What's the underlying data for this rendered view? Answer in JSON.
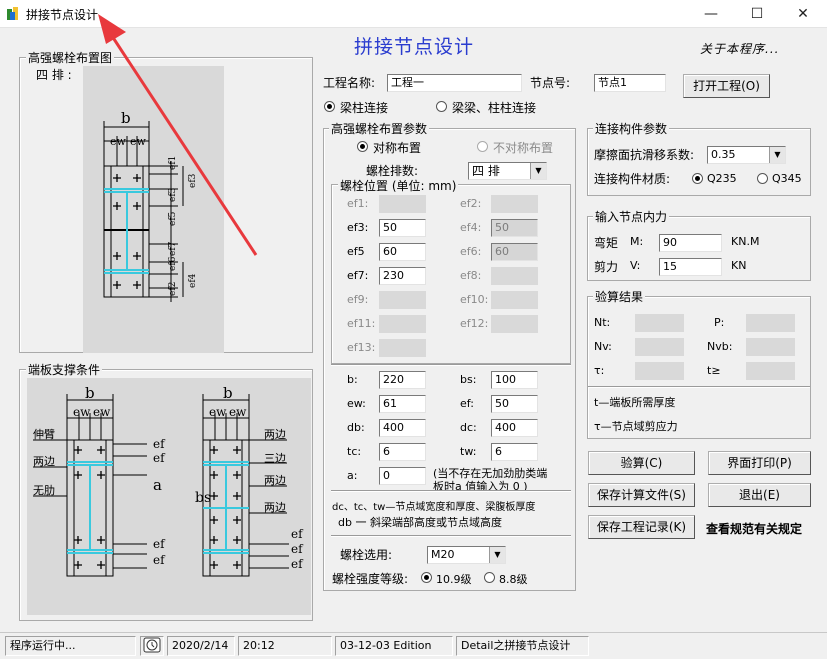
{
  "window": {
    "title": "拼接节点设计",
    "minimize": "—",
    "maximize": "☐",
    "close": "✕"
  },
  "header": {
    "main_title": "拼接节点设计",
    "about": "关于本程序..."
  },
  "bolt_layout_panel": {
    "title": "高强螺栓布置图",
    "rows_label": "四 排 :",
    "drawing": {
      "b": "b",
      "ew1": "ew",
      "ew2": "ew",
      "ef1": "ef1",
      "ef3": "ef3",
      "ef5": "ef5",
      "ef7": "ef7",
      "ef6": "ef6",
      "ef2": "ef2",
      "ef4": "ef4"
    }
  },
  "support_panel": {
    "title": "端板支撑条件",
    "left_labels": [
      "伸臂",
      "两边",
      "无肋"
    ],
    "right_labels": [
      "两边",
      "三边",
      "两边",
      "两边"
    ],
    "b": "b",
    "ew": "ew",
    "ef": "ef",
    "a": "a",
    "bs": "bs"
  },
  "project": {
    "name_label": "工程名称:",
    "name_value": "工程一",
    "node_label": "节点号:",
    "node_value": "节点1",
    "open_button": "打开工程(O)",
    "connection_types": [
      {
        "label": "梁柱连接",
        "selected": true
      },
      {
        "label": "梁梁、柱柱连接",
        "selected": false
      }
    ]
  },
  "bolt_params": {
    "title": "高强螺栓布置参数",
    "symmetric": "对称布置",
    "asymmetric": "不对称布置",
    "rows_label": "螺栓排数:",
    "rows_value": "四 排",
    "position_title": "螺栓位置 (单位: mm)",
    "left": [
      {
        "label": "ef1:",
        "value": "",
        "enabled": false
      },
      {
        "label": "ef3:",
        "value": "50",
        "enabled": true
      },
      {
        "label": "ef5",
        "value": "60",
        "enabled": true
      },
      {
        "label": "ef7:",
        "value": "230",
        "enabled": true
      },
      {
        "label": "ef9:",
        "value": "",
        "enabled": false
      },
      {
        "label": "ef11:",
        "value": "",
        "enabled": false
      },
      {
        "label": "ef13:",
        "value": "",
        "enabled": false
      }
    ],
    "right": [
      {
        "label": "ef2:",
        "value": "",
        "enabled": false
      },
      {
        "label": "ef4:",
        "value": "50",
        "enabled": false
      },
      {
        "label": "ef6:",
        "value": "60",
        "enabled": false
      },
      {
        "label": "ef8:",
        "value": "",
        "enabled": false
      },
      {
        "label": "ef10:",
        "value": "",
        "enabled": false
      },
      {
        "label": "ef12:",
        "value": "",
        "enabled": false
      }
    ],
    "dims_left": [
      {
        "label": "b:",
        "value": "220"
      },
      {
        "label": "ew:",
        "value": "61"
      },
      {
        "label": "db:",
        "value": "400"
      },
      {
        "label": "tc:",
        "value": "6"
      },
      {
        "label": "a:",
        "value": "0"
      }
    ],
    "dims_right": [
      {
        "label": "bs:",
        "value": "100"
      },
      {
        "label": "ef:",
        "value": "50"
      },
      {
        "label": "dc:",
        "value": "400"
      },
      {
        "label": "tw:",
        "value": "6"
      }
    ],
    "a_note_line1": "(当不存在无加劲肋类端",
    "a_note_line2": "板时a 值输入为 0 )",
    "note_line1": "dc、tc、tw—节点域宽度和厚度、梁腹板厚度",
    "note_line2": "db 一 斜梁端部高度或节点域高度",
    "bolt_select_label": "螺栓选用:",
    "bolt_select_value": "M20",
    "grade_label": "螺栓强度等级:",
    "grades": [
      {
        "label": "10.9级",
        "selected": true
      },
      {
        "label": "8.8级",
        "selected": false
      }
    ]
  },
  "member_params": {
    "title": "连接构件参数",
    "friction_label": "摩擦面抗滑移系数:",
    "friction_value": "0.35",
    "material_label": "连接构件材质:",
    "materials": [
      {
        "label": "Q235",
        "selected": true
      },
      {
        "label": "Q345",
        "selected": false
      }
    ]
  },
  "forces": {
    "title": "输入节点内力",
    "moment_label": "弯矩",
    "moment_sym": "M:",
    "moment_value": "90",
    "moment_unit": "KN.M",
    "shear_label": "剪力",
    "shear_sym": "V:",
    "shear_value": "15",
    "shear_unit": "KN"
  },
  "results": {
    "title": "验算结果",
    "labels": [
      "Nt:",
      "P:",
      "Nv:",
      "Nvb:",
      "τ:",
      "t≥"
    ],
    "note1": "t—端板所需厚度",
    "note2": "τ—节点域剪应力"
  },
  "buttons": {
    "check": "验算(C)",
    "print": "界面打印(P)",
    "save_calc": "保存计算文件(S)",
    "exit": "退出(E)",
    "save_record": "保存工程记录(K)",
    "spec": "查看规范有关规定"
  },
  "status": {
    "state": "程序运行中...",
    "date": "2020/2/14",
    "time": "20:12",
    "edition": "03-12-03 Edition",
    "app": "Detail之拼接节点设计"
  },
  "colors": {
    "heading_blue": "#2a3ccf",
    "arrow_red": "#e8393d",
    "cyan_line": "#39c9de"
  }
}
